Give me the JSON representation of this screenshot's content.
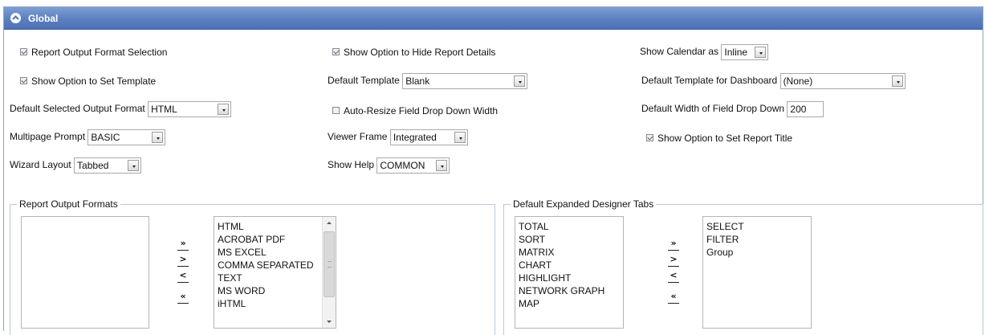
{
  "panel": {
    "title": "Global",
    "collapse_icon": "chevron-up-icon"
  },
  "options": {
    "report_output_format_selection": {
      "label": "Report Output Format Selection",
      "checked": true
    },
    "show_option_hide_report_details": {
      "label": "Show Option to Hide Report Details",
      "checked": true
    },
    "show_calendar_as": {
      "label": "Show Calendar as",
      "value": "Inline"
    },
    "show_option_set_template": {
      "label": "Show Option to Set Template",
      "checked": true
    },
    "default_template": {
      "label": "Default Template",
      "value": "Blank"
    },
    "default_template_dashboard": {
      "label": "Default Template for Dashboard",
      "value": "(None)"
    },
    "default_selected_output_format": {
      "label": "Default Selected Output Format",
      "value": "HTML"
    },
    "auto_resize_field_drop_down": {
      "label": "Auto-Resize Field Drop Down Width",
      "checked": false
    },
    "default_width_field_drop_down": {
      "label": "Default Width of Field Drop Down",
      "value": "200"
    },
    "multipage_prompt": {
      "label": "Multipage Prompt",
      "value": "BASIC"
    },
    "viewer_frame": {
      "label": "Viewer Frame",
      "value": "Integrated"
    },
    "show_option_set_report_title": {
      "label": "Show Option to Set Report Title",
      "checked": true
    },
    "wizard_layout": {
      "label": "Wizard Layout",
      "value": "Tabbed"
    },
    "show_help": {
      "label": "Show Help",
      "value": "COMMON"
    }
  },
  "report_output_formats": {
    "legend": "Report Output Formats",
    "available": [],
    "selected": [
      "HTML",
      "ACROBAT PDF",
      "MS EXCEL",
      "COMMA SEPARATED",
      "TEXT",
      "MS WORD",
      "iHTML"
    ],
    "buttons": {
      "move_all_right": "»",
      "move_right": ">",
      "move_left": "<",
      "move_all_left": "«"
    }
  },
  "default_expanded_designer_tabs": {
    "legend": "Default Expanded Designer Tabs",
    "available": [
      "TOTAL",
      "SORT",
      "MATRIX",
      "CHART",
      "HIGHLIGHT",
      "NETWORK GRAPH",
      "MAP"
    ],
    "selected": [
      "SELECT",
      "FILTER",
      "Group"
    ],
    "buttons": {
      "move_all_right": "»",
      "move_right": ">",
      "move_left": "<",
      "move_all_left": "«"
    }
  }
}
